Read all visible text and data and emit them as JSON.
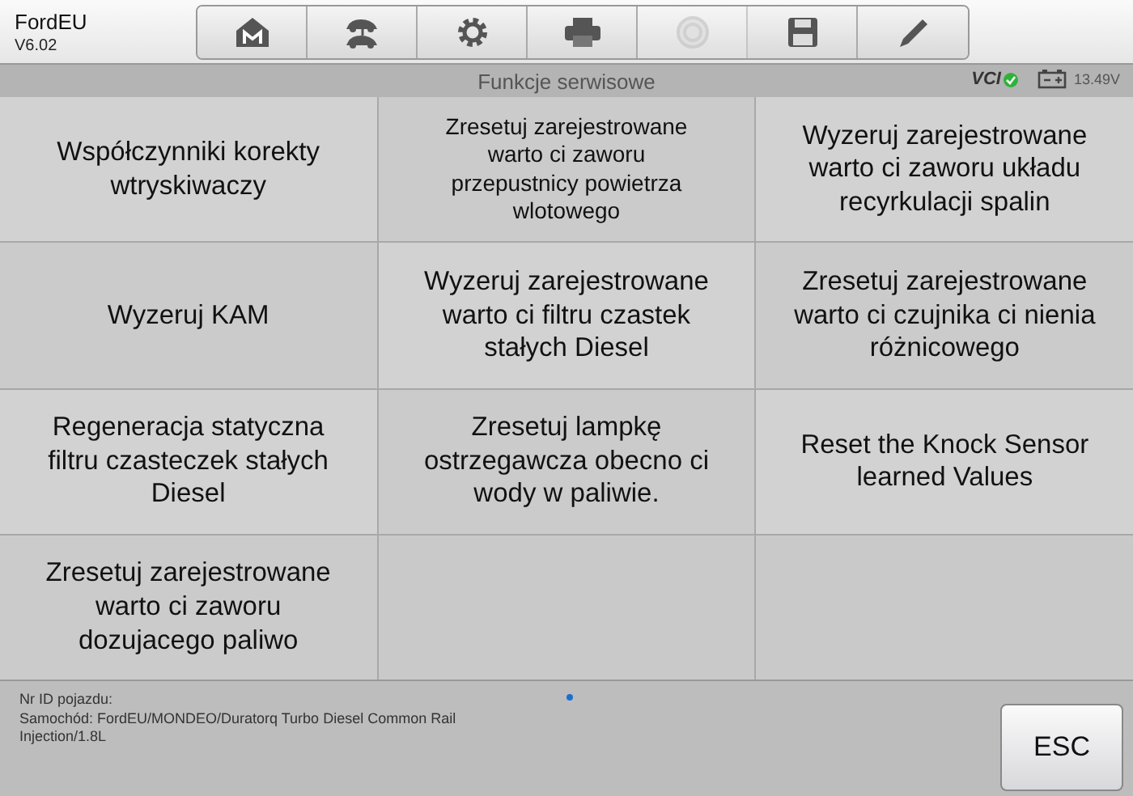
{
  "app": {
    "name": "FordEU",
    "version": "V6.02"
  },
  "toolbar": [
    {
      "disabled": false
    },
    {
      "disabled": false
    },
    {
      "disabled": false
    },
    {
      "disabled": false
    },
    {
      "disabled": true
    },
    {
      "disabled": false
    },
    {
      "disabled": false
    }
  ],
  "status_bar": {
    "title": "Funkcje serwisowe",
    "vci": "VCI",
    "vci_connected": true,
    "voltage": "13.49V"
  },
  "functions": [
    {
      "label": "Współczynniki korekty wtryskiwaczy"
    },
    {
      "label": "Zresetuj zarejestrowane warto ci zaworu przepustnicy powietrza wlotowego"
    },
    {
      "label": "Wyzeruj zarejestrowane warto ci zaworu układu recyrkulacji spalin"
    },
    {
      "label": "Wyzeruj KAM"
    },
    {
      "label": "Wyzeruj zarejestrowane warto ci filtru czastek stałych Diesel"
    },
    {
      "label": "Zresetuj zarejestrowane warto ci czujnika ci nienia różnicowego"
    },
    {
      "label": "Regeneracja statyczna filtru czasteczek stałych Diesel"
    },
    {
      "label": "Zresetuj lampkę ostrzegawcza obecno ci wody w paliwie."
    },
    {
      "label": "Reset the Knock Sensor learned Values"
    },
    {
      "label": "Zresetuj zarejestrowane warto ci zaworu dozujacego paliwo"
    }
  ],
  "footer": {
    "vehicle_id": "Nr ID pojazdu:",
    "vehicle": "Samochód: FordEU/MONDEO/Duratorq Turbo Diesel Common Rail Injection/1.8L",
    "esc": "ESC"
  }
}
